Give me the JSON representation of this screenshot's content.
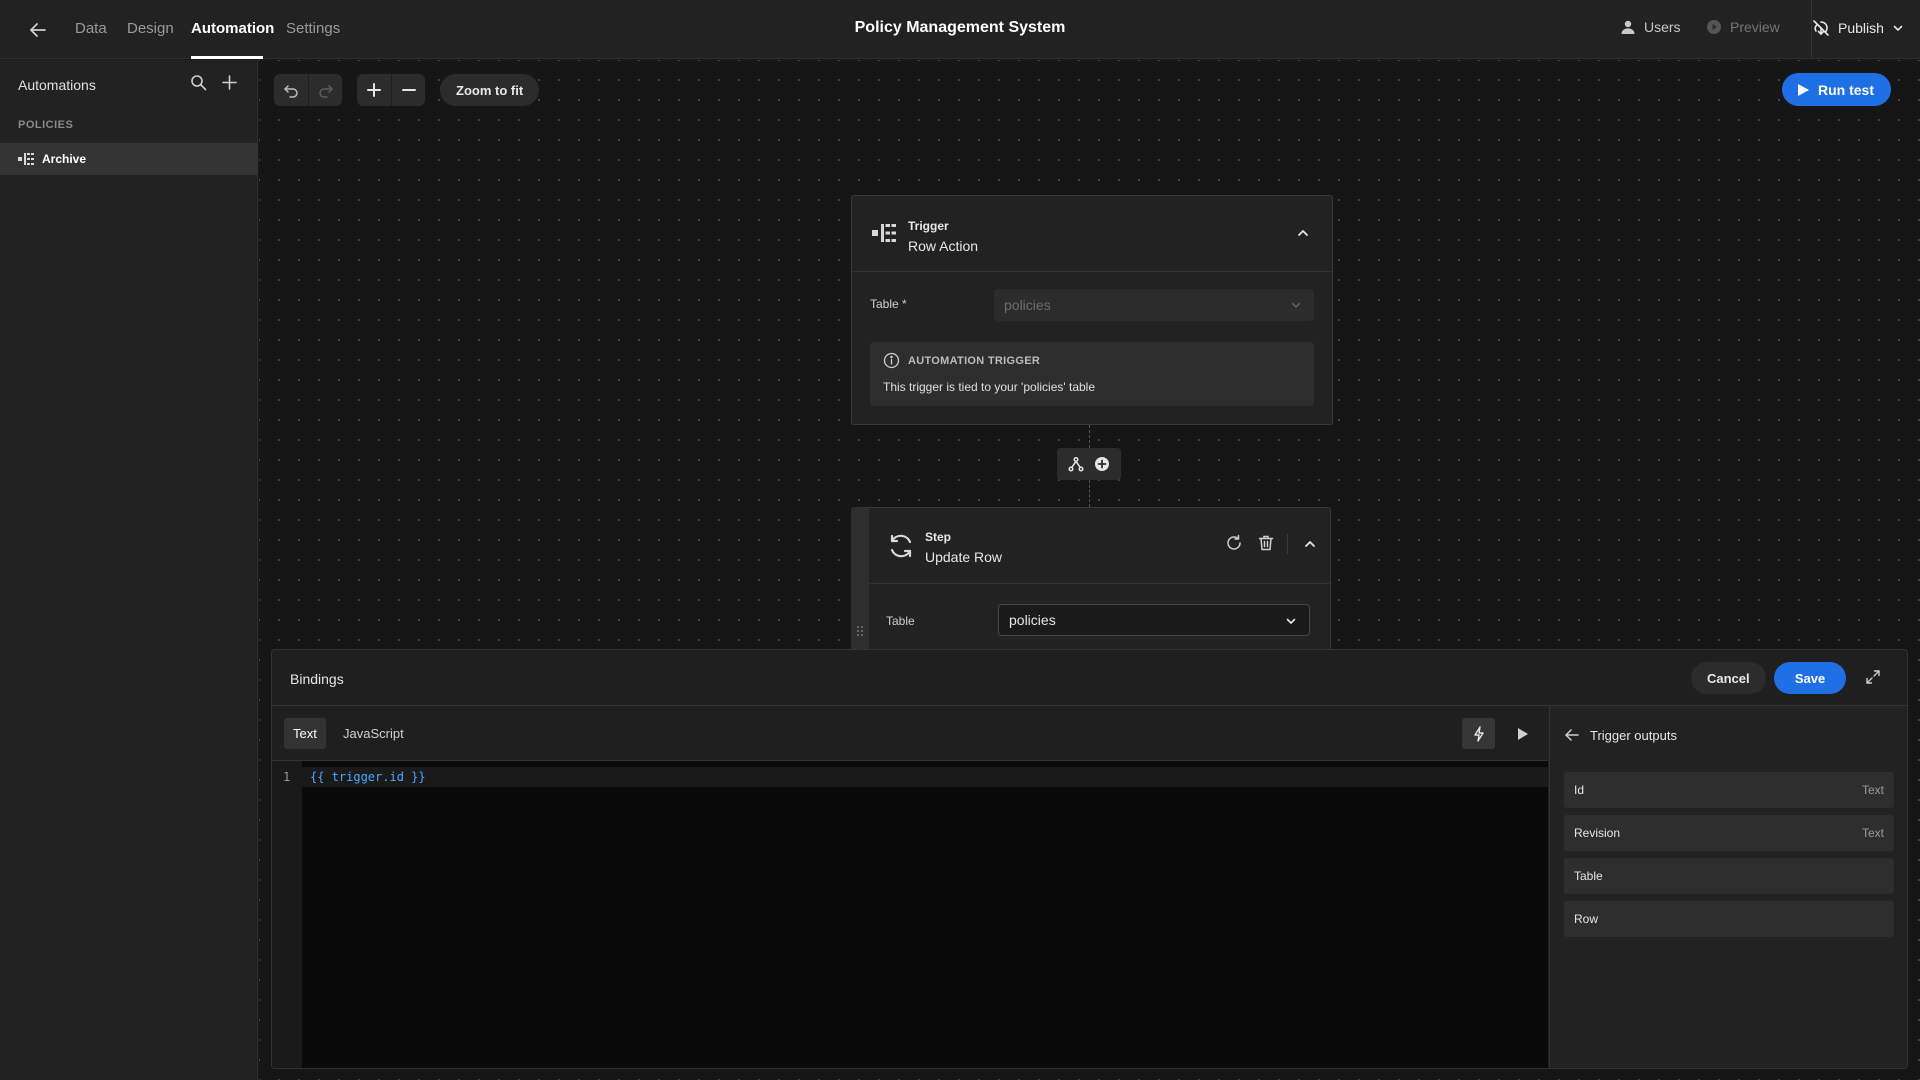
{
  "app": {
    "title": "Policy Management System"
  },
  "nav": {
    "tabs": [
      "Data",
      "Design",
      "Automation",
      "Settings"
    ],
    "active": "Automation"
  },
  "topRight": {
    "users": "Users",
    "preview": "Preview",
    "publish": "Publish"
  },
  "sidebar": {
    "title": "Automations",
    "section": "POLICIES",
    "items": [
      {
        "label": "Archive"
      }
    ]
  },
  "toolbar": {
    "zoom_fit": "Zoom to fit",
    "run_test": "Run test"
  },
  "trigger": {
    "kind": "Trigger",
    "name": "Row Action",
    "table_label": "Table *",
    "table_value": "policies",
    "info_title": "AUTOMATION TRIGGER",
    "info_text": "This trigger is tied to your 'policies' table"
  },
  "step": {
    "kind": "Step",
    "name": "Update Row",
    "table_label": "Table",
    "table_value": "policies"
  },
  "bindings": {
    "title": "Bindings",
    "cancel": "Cancel",
    "save": "Save",
    "tabs": [
      "Text",
      "JavaScript"
    ],
    "active_tab": "Text",
    "line_number": "1",
    "code": "{{ trigger.id }}",
    "outputs_title": "Trigger outputs",
    "outputs": [
      {
        "name": "Id",
        "type": "Text"
      },
      {
        "name": "Revision",
        "type": "Text"
      },
      {
        "name": "Table",
        "type": ""
      },
      {
        "name": "Row",
        "type": ""
      }
    ]
  },
  "colors": {
    "accent": "#1f6fe5",
    "code": "#4aa8ff",
    "background": "#161616"
  }
}
